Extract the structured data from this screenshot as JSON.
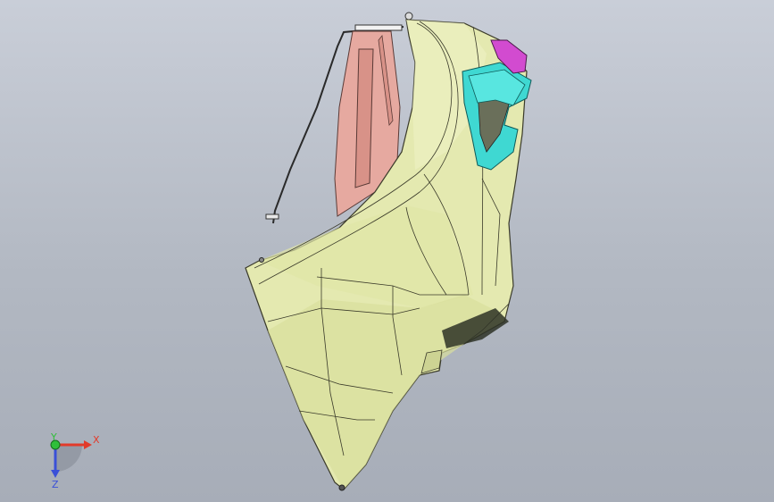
{
  "viewport": {
    "background_top": "#c9ced8",
    "background_bottom": "#a7adb8"
  },
  "model": {
    "parts": [
      {
        "name": "hood-shell",
        "color": "#e4e9b0"
      },
      {
        "name": "side-bracket",
        "color": "#e6a9a0"
      },
      {
        "name": "lamp-housing",
        "color": "#3fd8d2"
      },
      {
        "name": "top-clip",
        "color": "#d24bd0"
      },
      {
        "name": "wire-rod",
        "color": "#2a2a2a"
      }
    ],
    "edge_color": "#3a3a2a"
  },
  "triad": {
    "x_label": "X",
    "y_label": "Y",
    "z_label": "Z",
    "x_color": "#e23a2a",
    "y_color": "#2fbf3a",
    "z_color": "#3a50d8"
  }
}
